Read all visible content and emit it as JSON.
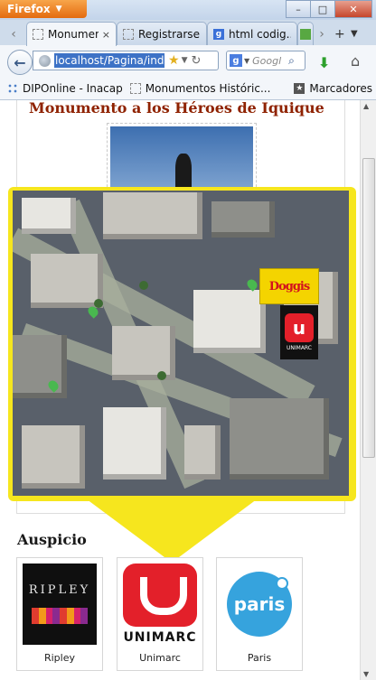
{
  "browser": {
    "app_menu_label": "Firefox",
    "window_controls": [
      "–",
      "□",
      "✕"
    ]
  },
  "tabs": [
    {
      "title": "Monumento...",
      "close": "×",
      "active": true,
      "icon": "blank-page-icon"
    },
    {
      "title": "Registrarse",
      "active": false,
      "icon": "blank-page-icon"
    },
    {
      "title": "html codig...",
      "active": false,
      "icon": "google-icon"
    },
    {
      "title": "",
      "active": false,
      "icon": "green-favicon"
    }
  ],
  "toolbar": {
    "url": "localhost/Pagina/inde",
    "search_engine_icon": "g",
    "search_placeholder": "Googl"
  },
  "bookmarks": [
    {
      "label": "DIPOnline - Inacap",
      "icon": "dots-favicon"
    },
    {
      "label": "Monumentos Históric...",
      "icon": "blank-page-icon"
    },
    {
      "label": "Marcadores",
      "icon": "bookmarks-star-icon"
    }
  ],
  "page": {
    "title": "Monumento a los Héroes de Iquique",
    "popup_signs": {
      "doggis": "Doggis",
      "unimarc": "UNIMARC"
    },
    "sponsors_heading": "Auspicio",
    "sponsors": [
      {
        "name": "Ripley",
        "logo_text": "RIPLEY"
      },
      {
        "name": "Unimarc",
        "logo_text": "UNIMARC"
      },
      {
        "name": "Paris",
        "logo_text": "paris"
      }
    ]
  },
  "colors": {
    "popup_yellow": "#f6e61e",
    "title_red": "#8f2200",
    "firefox_orange": "#e46b10"
  }
}
